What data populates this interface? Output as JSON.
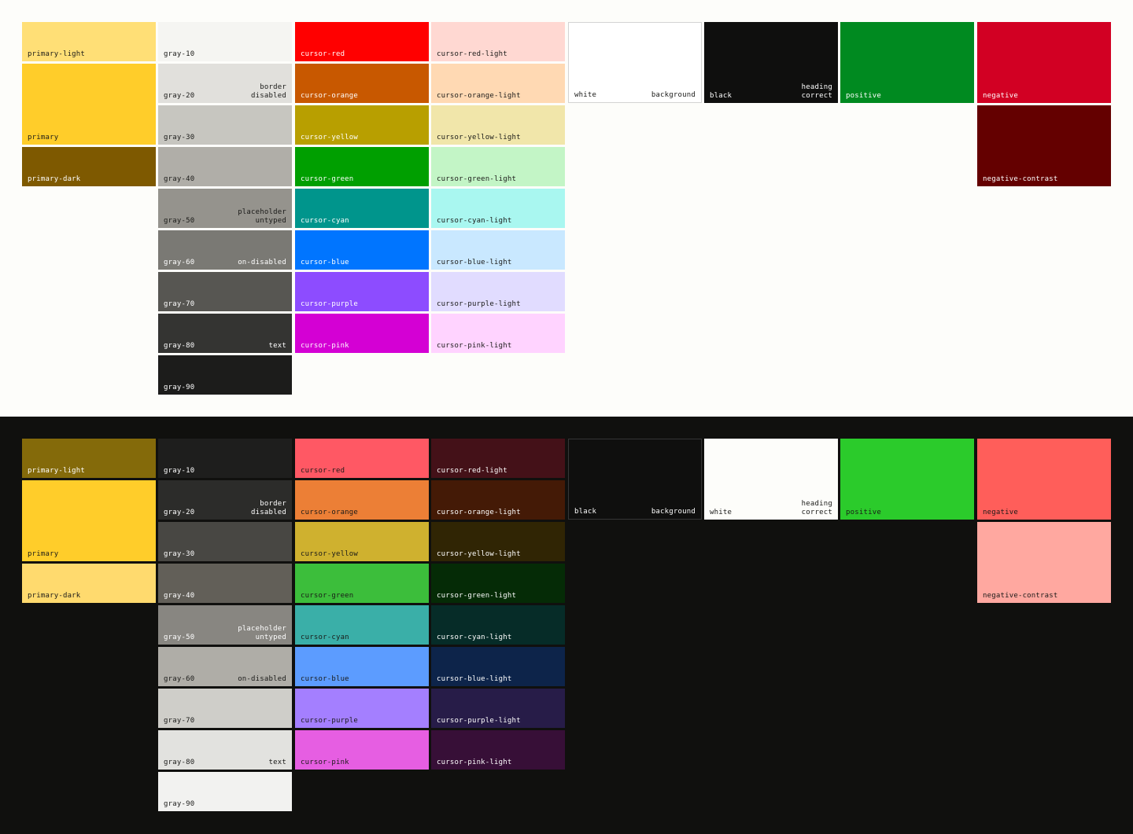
{
  "light": {
    "page_bg": "#FDFDFA",
    "columns": [
      [
        {
          "label": "primary-light",
          "color": "#FFDF76",
          "text": "#1A1A18",
          "tall": false,
          "tags": []
        },
        {
          "label": "primary",
          "color": "#FFCD2A",
          "text": "#1A1A18",
          "tall": true,
          "tags": []
        },
        {
          "label": "primary-dark",
          "color": "#7E5900",
          "text": "#FFFFFF",
          "tall": false,
          "tags": []
        }
      ],
      [
        {
          "label": "gray-10",
          "color": "#F5F5F2",
          "text": "#1A1A18",
          "tall": false,
          "tags": []
        },
        {
          "label": "gray-20",
          "color": "#E1E0DC",
          "text": "#1A1A18",
          "tall": false,
          "tags": [
            "border",
            "disabled"
          ]
        },
        {
          "label": "gray-30",
          "color": "#C7C6C0",
          "text": "#1A1A18",
          "tall": false,
          "tags": []
        },
        {
          "label": "gray-40",
          "color": "#B0AEA8",
          "text": "#1A1A18",
          "tall": false,
          "tags": []
        },
        {
          "label": "gray-50",
          "color": "#95938D",
          "text": "#1A1A18",
          "tall": false,
          "tags": [
            "placeholder",
            "untyped"
          ]
        },
        {
          "label": "gray-60",
          "color": "#7A7974",
          "text": "#FFFFFF",
          "tall": false,
          "tags": [
            "on-disabled"
          ]
        },
        {
          "label": "gray-70",
          "color": "#575652",
          "text": "#FFFFFF",
          "tall": false,
          "tags": []
        },
        {
          "label": "gray-80",
          "color": "#343432",
          "text": "#FFFFFF",
          "tall": false,
          "tags": [
            "text"
          ]
        },
        {
          "label": "gray-90",
          "color": "#1C1C1B",
          "text": "#FFFFFF",
          "tall": false,
          "tags": []
        }
      ],
      [
        {
          "label": "cursor-red",
          "color": "#FF0000",
          "text": "#FFFFFF",
          "tall": false,
          "tags": []
        },
        {
          "label": "cursor-orange",
          "color": "#C85800",
          "text": "#FFFFFF",
          "tall": false,
          "tags": []
        },
        {
          "label": "cursor-yellow",
          "color": "#B89F00",
          "text": "#FFFFFF",
          "tall": false,
          "tags": []
        },
        {
          "label": "cursor-green",
          "color": "#009F00",
          "text": "#FFFFFF",
          "tall": false,
          "tags": []
        },
        {
          "label": "cursor-cyan",
          "color": "#00958C",
          "text": "#FFFFFF",
          "tall": false,
          "tags": []
        },
        {
          "label": "cursor-blue",
          "color": "#0075FF",
          "text": "#FFFFFF",
          "tall": false,
          "tags": []
        },
        {
          "label": "cursor-purple",
          "color": "#8D4CFF",
          "text": "#FFFFFF",
          "tall": false,
          "tags": []
        },
        {
          "label": "cursor-pink",
          "color": "#D400D4",
          "text": "#FFFFFF",
          "tall": false,
          "tags": []
        }
      ],
      [
        {
          "label": "cursor-red-light",
          "color": "#FFD8D2",
          "text": "#1A1A18",
          "tall": false,
          "tags": []
        },
        {
          "label": "cursor-orange-light",
          "color": "#FFD9B3",
          "text": "#1A1A18",
          "tall": false,
          "tags": []
        },
        {
          "label": "cursor-yellow-light",
          "color": "#F1E6AA",
          "text": "#1A1A18",
          "tall": false,
          "tags": []
        },
        {
          "label": "cursor-green-light",
          "color": "#C3F5C6",
          "text": "#1A1A18",
          "tall": false,
          "tags": []
        },
        {
          "label": "cursor-cyan-light",
          "color": "#A9F7F0",
          "text": "#1A1A18",
          "tall": false,
          "tags": []
        },
        {
          "label": "cursor-blue-light",
          "color": "#C9E8FF",
          "text": "#1A1A18",
          "tall": false,
          "tags": []
        },
        {
          "label": "cursor-purple-light",
          "color": "#E1DCFF",
          "text": "#1A1A18",
          "tall": false,
          "tags": []
        },
        {
          "label": "cursor-pink-light",
          "color": "#FFD3FF",
          "text": "#1A1A18",
          "tall": false,
          "tags": []
        }
      ],
      [
        {
          "label": "white",
          "color": "#FFFFFF",
          "text": "#1A1A18",
          "tall": true,
          "outline": true,
          "tags": [
            "background"
          ]
        }
      ],
      [
        {
          "label": "black",
          "color": "#0F0F0E",
          "text": "#FFFFFF",
          "tall": true,
          "tags": [
            "heading",
            "correct"
          ]
        }
      ],
      [
        {
          "label": "positive",
          "color": "#008A20",
          "text": "#FFFFFF",
          "tall": true,
          "tags": []
        }
      ],
      [
        {
          "label": "negative",
          "color": "#D20023",
          "text": "#FFFFFF",
          "tall": true,
          "tags": []
        },
        {
          "label": "negative-contrast",
          "color": "#640000",
          "text": "#FFFFFF",
          "tall": true,
          "tags": []
        }
      ]
    ]
  },
  "dark": {
    "page_bg": "#10100E",
    "columns": [
      [
        {
          "label": "primary-light",
          "color": "#846A0A",
          "text": "#FFFFFF",
          "tall": false,
          "tags": []
        },
        {
          "label": "primary",
          "color": "#FFCD2A",
          "text": "#1A1A18",
          "tall": true,
          "tags": []
        },
        {
          "label": "primary-dark",
          "color": "#FFDA6E",
          "text": "#1A1A18",
          "tall": false,
          "tags": []
        }
      ],
      [
        {
          "label": "gray-10",
          "color": "#1E1E1D",
          "text": "#FFFFFF",
          "tall": false,
          "tags": []
        },
        {
          "label": "gray-20",
          "color": "#2C2C2A",
          "text": "#FFFFFF",
          "tall": false,
          "tags": [
            "border",
            "disabled"
          ]
        },
        {
          "label": "gray-30",
          "color": "#484743",
          "text": "#FFFFFF",
          "tall": false,
          "tags": []
        },
        {
          "label": "gray-40",
          "color": "#625F58",
          "text": "#FFFFFF",
          "tall": false,
          "tags": []
        },
        {
          "label": "gray-50",
          "color": "#888681",
          "text": "#FFFFFF",
          "tall": false,
          "tags": [
            "placeholder",
            "untyped"
          ]
        },
        {
          "label": "gray-60",
          "color": "#AFADA7",
          "text": "#1A1A18",
          "tall": false,
          "tags": [
            "on-disabled"
          ]
        },
        {
          "label": "gray-70",
          "color": "#CFCEC9",
          "text": "#1A1A18",
          "tall": false,
          "tags": []
        },
        {
          "label": "gray-80",
          "color": "#E2E2DF",
          "text": "#1A1A18",
          "tall": false,
          "tags": [
            "text"
          ]
        },
        {
          "label": "gray-90",
          "color": "#F2F2F0",
          "text": "#1A1A18",
          "tall": false,
          "tags": []
        }
      ],
      [
        {
          "label": "cursor-red",
          "color": "#FF5864",
          "text": "#1A1A18",
          "tall": false,
          "tags": []
        },
        {
          "label": "cursor-orange",
          "color": "#EC7F36",
          "text": "#1A1A18",
          "tall": false,
          "tags": []
        },
        {
          "label": "cursor-yellow",
          "color": "#CFB12F",
          "text": "#1A1A18",
          "tall": false,
          "tags": []
        },
        {
          "label": "cursor-green",
          "color": "#3CBE3B",
          "text": "#1A1A18",
          "tall": false,
          "tags": []
        },
        {
          "label": "cursor-cyan",
          "color": "#3AAFA8",
          "text": "#1A1A18",
          "tall": false,
          "tags": []
        },
        {
          "label": "cursor-blue",
          "color": "#5C9CFF",
          "text": "#1A1A18",
          "tall": false,
          "tags": []
        },
        {
          "label": "cursor-purple",
          "color": "#A47FFF",
          "text": "#1A1A18",
          "tall": false,
          "tags": []
        },
        {
          "label": "cursor-pink",
          "color": "#E65EE2",
          "text": "#1A1A18",
          "tall": false,
          "tags": []
        }
      ],
      [
        {
          "label": "cursor-red-light",
          "color": "#441118",
          "text": "#FFFFFF",
          "tall": false,
          "tags": []
        },
        {
          "label": "cursor-orange-light",
          "color": "#441A06",
          "text": "#FFFFFF",
          "tall": false,
          "tags": []
        },
        {
          "label": "cursor-yellow-light",
          "color": "#302504",
          "text": "#FFFFFF",
          "tall": false,
          "tags": []
        },
        {
          "label": "cursor-green-light",
          "color": "#052B06",
          "text": "#FFFFFF",
          "tall": false,
          "tags": []
        },
        {
          "label": "cursor-cyan-light",
          "color": "#062C28",
          "text": "#FFFFFF",
          "tall": false,
          "tags": []
        },
        {
          "label": "cursor-blue-light",
          "color": "#0D244A",
          "text": "#FFFFFF",
          "tall": false,
          "tags": []
        },
        {
          "label": "cursor-purple-light",
          "color": "#271C48",
          "text": "#FFFFFF",
          "tall": false,
          "tags": []
        },
        {
          "label": "cursor-pink-light",
          "color": "#370F37",
          "text": "#FFFFFF",
          "tall": false,
          "tags": []
        }
      ],
      [
        {
          "label": "black",
          "color": "#0F0F0E",
          "text": "#FFFFFF",
          "tall": true,
          "outline": true,
          "tags": [
            "background"
          ]
        }
      ],
      [
        {
          "label": "white",
          "color": "#FDFDFA",
          "text": "#1A1A18",
          "tall": true,
          "tags": [
            "heading",
            "correct"
          ]
        }
      ],
      [
        {
          "label": "positive",
          "color": "#2BCB2B",
          "text": "#1A1A18",
          "tall": true,
          "tags": []
        }
      ],
      [
        {
          "label": "negative",
          "color": "#FF5E5A",
          "text": "#1A1A18",
          "tall": true,
          "tags": []
        },
        {
          "label": "negative-contrast",
          "color": "#FFA8A0",
          "text": "#1A1A18",
          "tall": true,
          "tags": []
        }
      ]
    ]
  }
}
